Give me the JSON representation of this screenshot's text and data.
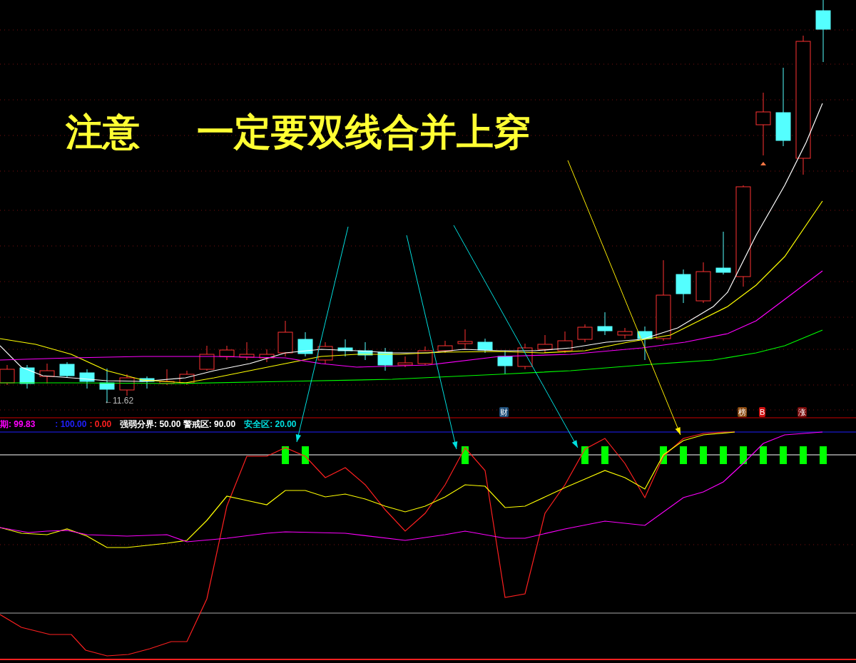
{
  "annotation": {
    "texts": [
      "注意",
      "一定要双线合并上穿"
    ]
  },
  "price_chart": {
    "low_label": "←11.62",
    "event_badges": [
      {
        "label": "财",
        "color": "#1f4e79"
      },
      {
        "label": "榜",
        "color": "#8b4a10"
      },
      {
        "label": "B",
        "color": "#d01010"
      },
      {
        "label": "涨",
        "color": "#7a0a0a"
      }
    ]
  },
  "indicator": {
    "legend": [
      {
        "text": "期: 99.83",
        "color": "#ff00ff"
      },
      {
        "text": ": 100.00",
        "color": "#2020ff"
      },
      {
        "text": ": 0.00",
        "color": "#ff2020"
      },
      {
        "text": "强弱分界: 50.00 警戒区: 90.00",
        "color": "#ffffff"
      },
      {
        "text": "安全区: 20.00",
        "color": "#00e0e0"
      }
    ]
  }
}
